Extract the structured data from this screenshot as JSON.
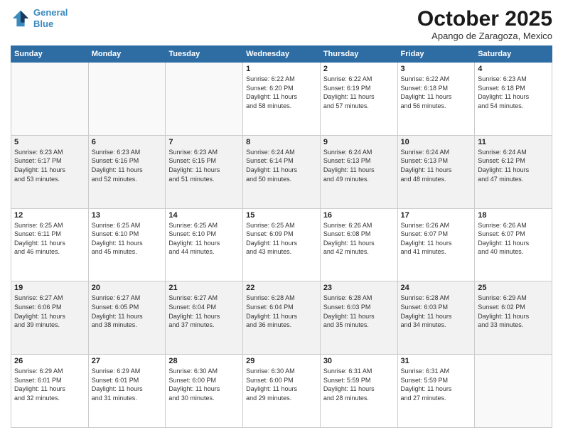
{
  "header": {
    "logo_line1": "General",
    "logo_line2": "Blue",
    "month": "October 2025",
    "location": "Apango de Zaragoza, Mexico"
  },
  "days_of_week": [
    "Sunday",
    "Monday",
    "Tuesday",
    "Wednesday",
    "Thursday",
    "Friday",
    "Saturday"
  ],
  "weeks": [
    [
      {
        "day": "",
        "info": ""
      },
      {
        "day": "",
        "info": ""
      },
      {
        "day": "",
        "info": ""
      },
      {
        "day": "1",
        "info": "Sunrise: 6:22 AM\nSunset: 6:20 PM\nDaylight: 11 hours\nand 58 minutes."
      },
      {
        "day": "2",
        "info": "Sunrise: 6:22 AM\nSunset: 6:19 PM\nDaylight: 11 hours\nand 57 minutes."
      },
      {
        "day": "3",
        "info": "Sunrise: 6:22 AM\nSunset: 6:18 PM\nDaylight: 11 hours\nand 56 minutes."
      },
      {
        "day": "4",
        "info": "Sunrise: 6:23 AM\nSunset: 6:18 PM\nDaylight: 11 hours\nand 54 minutes."
      }
    ],
    [
      {
        "day": "5",
        "info": "Sunrise: 6:23 AM\nSunset: 6:17 PM\nDaylight: 11 hours\nand 53 minutes."
      },
      {
        "day": "6",
        "info": "Sunrise: 6:23 AM\nSunset: 6:16 PM\nDaylight: 11 hours\nand 52 minutes."
      },
      {
        "day": "7",
        "info": "Sunrise: 6:23 AM\nSunset: 6:15 PM\nDaylight: 11 hours\nand 51 minutes."
      },
      {
        "day": "8",
        "info": "Sunrise: 6:24 AM\nSunset: 6:14 PM\nDaylight: 11 hours\nand 50 minutes."
      },
      {
        "day": "9",
        "info": "Sunrise: 6:24 AM\nSunset: 6:13 PM\nDaylight: 11 hours\nand 49 minutes."
      },
      {
        "day": "10",
        "info": "Sunrise: 6:24 AM\nSunset: 6:13 PM\nDaylight: 11 hours\nand 48 minutes."
      },
      {
        "day": "11",
        "info": "Sunrise: 6:24 AM\nSunset: 6:12 PM\nDaylight: 11 hours\nand 47 minutes."
      }
    ],
    [
      {
        "day": "12",
        "info": "Sunrise: 6:25 AM\nSunset: 6:11 PM\nDaylight: 11 hours\nand 46 minutes."
      },
      {
        "day": "13",
        "info": "Sunrise: 6:25 AM\nSunset: 6:10 PM\nDaylight: 11 hours\nand 45 minutes."
      },
      {
        "day": "14",
        "info": "Sunrise: 6:25 AM\nSunset: 6:10 PM\nDaylight: 11 hours\nand 44 minutes."
      },
      {
        "day": "15",
        "info": "Sunrise: 6:25 AM\nSunset: 6:09 PM\nDaylight: 11 hours\nand 43 minutes."
      },
      {
        "day": "16",
        "info": "Sunrise: 6:26 AM\nSunset: 6:08 PM\nDaylight: 11 hours\nand 42 minutes."
      },
      {
        "day": "17",
        "info": "Sunrise: 6:26 AM\nSunset: 6:07 PM\nDaylight: 11 hours\nand 41 minutes."
      },
      {
        "day": "18",
        "info": "Sunrise: 6:26 AM\nSunset: 6:07 PM\nDaylight: 11 hours\nand 40 minutes."
      }
    ],
    [
      {
        "day": "19",
        "info": "Sunrise: 6:27 AM\nSunset: 6:06 PM\nDaylight: 11 hours\nand 39 minutes."
      },
      {
        "day": "20",
        "info": "Sunrise: 6:27 AM\nSunset: 6:05 PM\nDaylight: 11 hours\nand 38 minutes."
      },
      {
        "day": "21",
        "info": "Sunrise: 6:27 AM\nSunset: 6:04 PM\nDaylight: 11 hours\nand 37 minutes."
      },
      {
        "day": "22",
        "info": "Sunrise: 6:28 AM\nSunset: 6:04 PM\nDaylight: 11 hours\nand 36 minutes."
      },
      {
        "day": "23",
        "info": "Sunrise: 6:28 AM\nSunset: 6:03 PM\nDaylight: 11 hours\nand 35 minutes."
      },
      {
        "day": "24",
        "info": "Sunrise: 6:28 AM\nSunset: 6:03 PM\nDaylight: 11 hours\nand 34 minutes."
      },
      {
        "day": "25",
        "info": "Sunrise: 6:29 AM\nSunset: 6:02 PM\nDaylight: 11 hours\nand 33 minutes."
      }
    ],
    [
      {
        "day": "26",
        "info": "Sunrise: 6:29 AM\nSunset: 6:01 PM\nDaylight: 11 hours\nand 32 minutes."
      },
      {
        "day": "27",
        "info": "Sunrise: 6:29 AM\nSunset: 6:01 PM\nDaylight: 11 hours\nand 31 minutes."
      },
      {
        "day": "28",
        "info": "Sunrise: 6:30 AM\nSunset: 6:00 PM\nDaylight: 11 hours\nand 30 minutes."
      },
      {
        "day": "29",
        "info": "Sunrise: 6:30 AM\nSunset: 6:00 PM\nDaylight: 11 hours\nand 29 minutes."
      },
      {
        "day": "30",
        "info": "Sunrise: 6:31 AM\nSunset: 5:59 PM\nDaylight: 11 hours\nand 28 minutes."
      },
      {
        "day": "31",
        "info": "Sunrise: 6:31 AM\nSunset: 5:59 PM\nDaylight: 11 hours\nand 27 minutes."
      },
      {
        "day": "",
        "info": ""
      }
    ]
  ]
}
